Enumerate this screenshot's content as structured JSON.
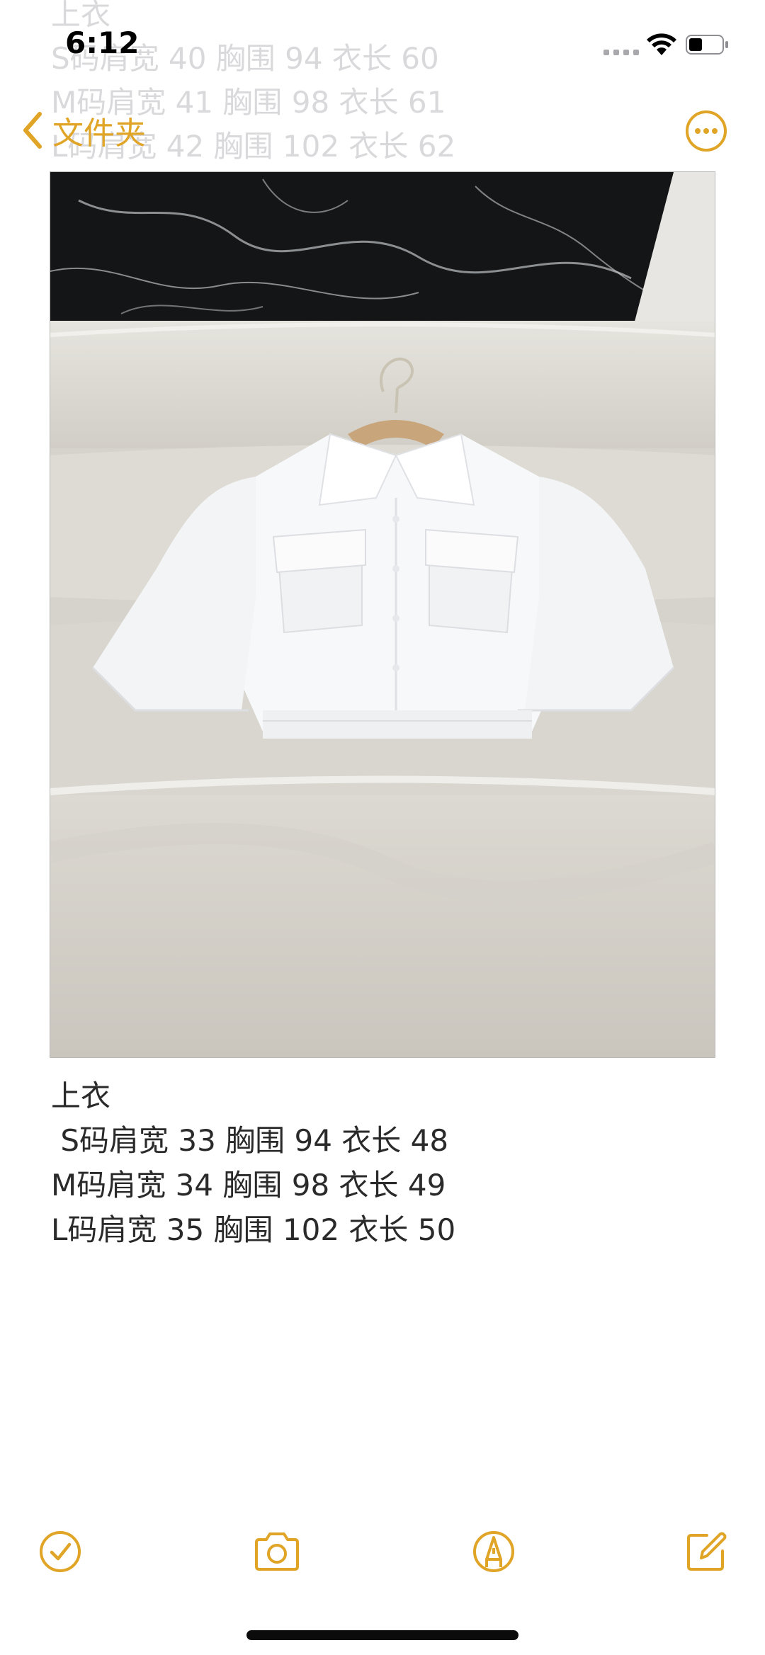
{
  "status": {
    "time": "6:12",
    "signal_icon": "signal-dots-icon",
    "wifi_icon": "wifi-icon",
    "battery_icon": "battery-icon"
  },
  "ghost_lines": [
    "上衣",
    "S码肩宽 40 胸围 94 衣长 60",
    "M码肩宽 41 胸围 98 衣长 61",
    "L码肩宽 42 胸围 102 衣长 62"
  ],
  "nav": {
    "back_label": "文件夹",
    "back_icon": "chevron-left-icon",
    "more_icon": "ellipsis-circle-icon"
  },
  "photo": {
    "subject": "white cropped shirt on wooden hanger",
    "bg_top": "#111214",
    "couch": "#dcdad4"
  },
  "note": {
    "lines": [
      "上衣",
      " S码肩宽 33 胸围 94 衣长 48",
      "M码肩宽 34 胸围 98 衣长 49",
      "L码肩宽 35 胸围 102 衣长 50"
    ]
  },
  "toolbar": {
    "checklist_icon": "checklist-icon",
    "camera_icon": "camera-icon",
    "markup_icon": "markup-pen-icon",
    "compose_icon": "compose-icon"
  },
  "colors": {
    "accent": "#e0a426",
    "text": "#2a2a2a"
  }
}
